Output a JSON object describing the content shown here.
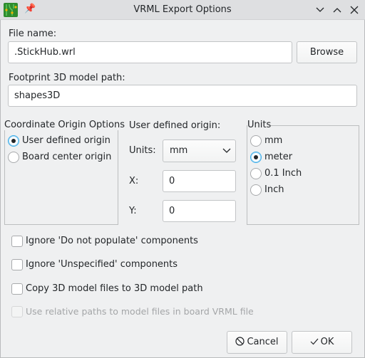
{
  "window": {
    "title": "VRML Export Options"
  },
  "file": {
    "label": "File name:",
    "value": ".StickHub.wrl",
    "browse": "Browse"
  },
  "footprint": {
    "label": "Footprint 3D model path:",
    "value": "shapes3D"
  },
  "origin_group": {
    "title": "Coordinate Origin Options",
    "options": [
      {
        "label": "User defined origin",
        "checked": true
      },
      {
        "label": "Board center origin",
        "checked": false
      }
    ]
  },
  "user_origin": {
    "title": "User defined origin:",
    "units_label": "Units:",
    "units_value": "mm",
    "x_label": "X:",
    "x_value": "0",
    "y_label": "Y:",
    "y_value": "0"
  },
  "units_group": {
    "title": "Units",
    "options": [
      {
        "label": "mm",
        "checked": false
      },
      {
        "label": "meter",
        "checked": true
      },
      {
        "label": "0.1 Inch",
        "checked": false
      },
      {
        "label": "Inch",
        "checked": false
      }
    ]
  },
  "checkboxes": [
    {
      "label": "Ignore 'Do not populate' components",
      "checked": false,
      "enabled": true
    },
    {
      "label": "Ignore 'Unspecified' components",
      "checked": false,
      "enabled": true
    },
    {
      "label": "Copy 3D model files to 3D model path",
      "checked": false,
      "enabled": true
    },
    {
      "label": "Use relative paths to model files in board VRML file",
      "checked": false,
      "enabled": false
    }
  ],
  "buttons": {
    "cancel": "Cancel",
    "ok": "OK"
  },
  "colors": {
    "accent": "#3daee9",
    "background": "#eff0f1"
  }
}
